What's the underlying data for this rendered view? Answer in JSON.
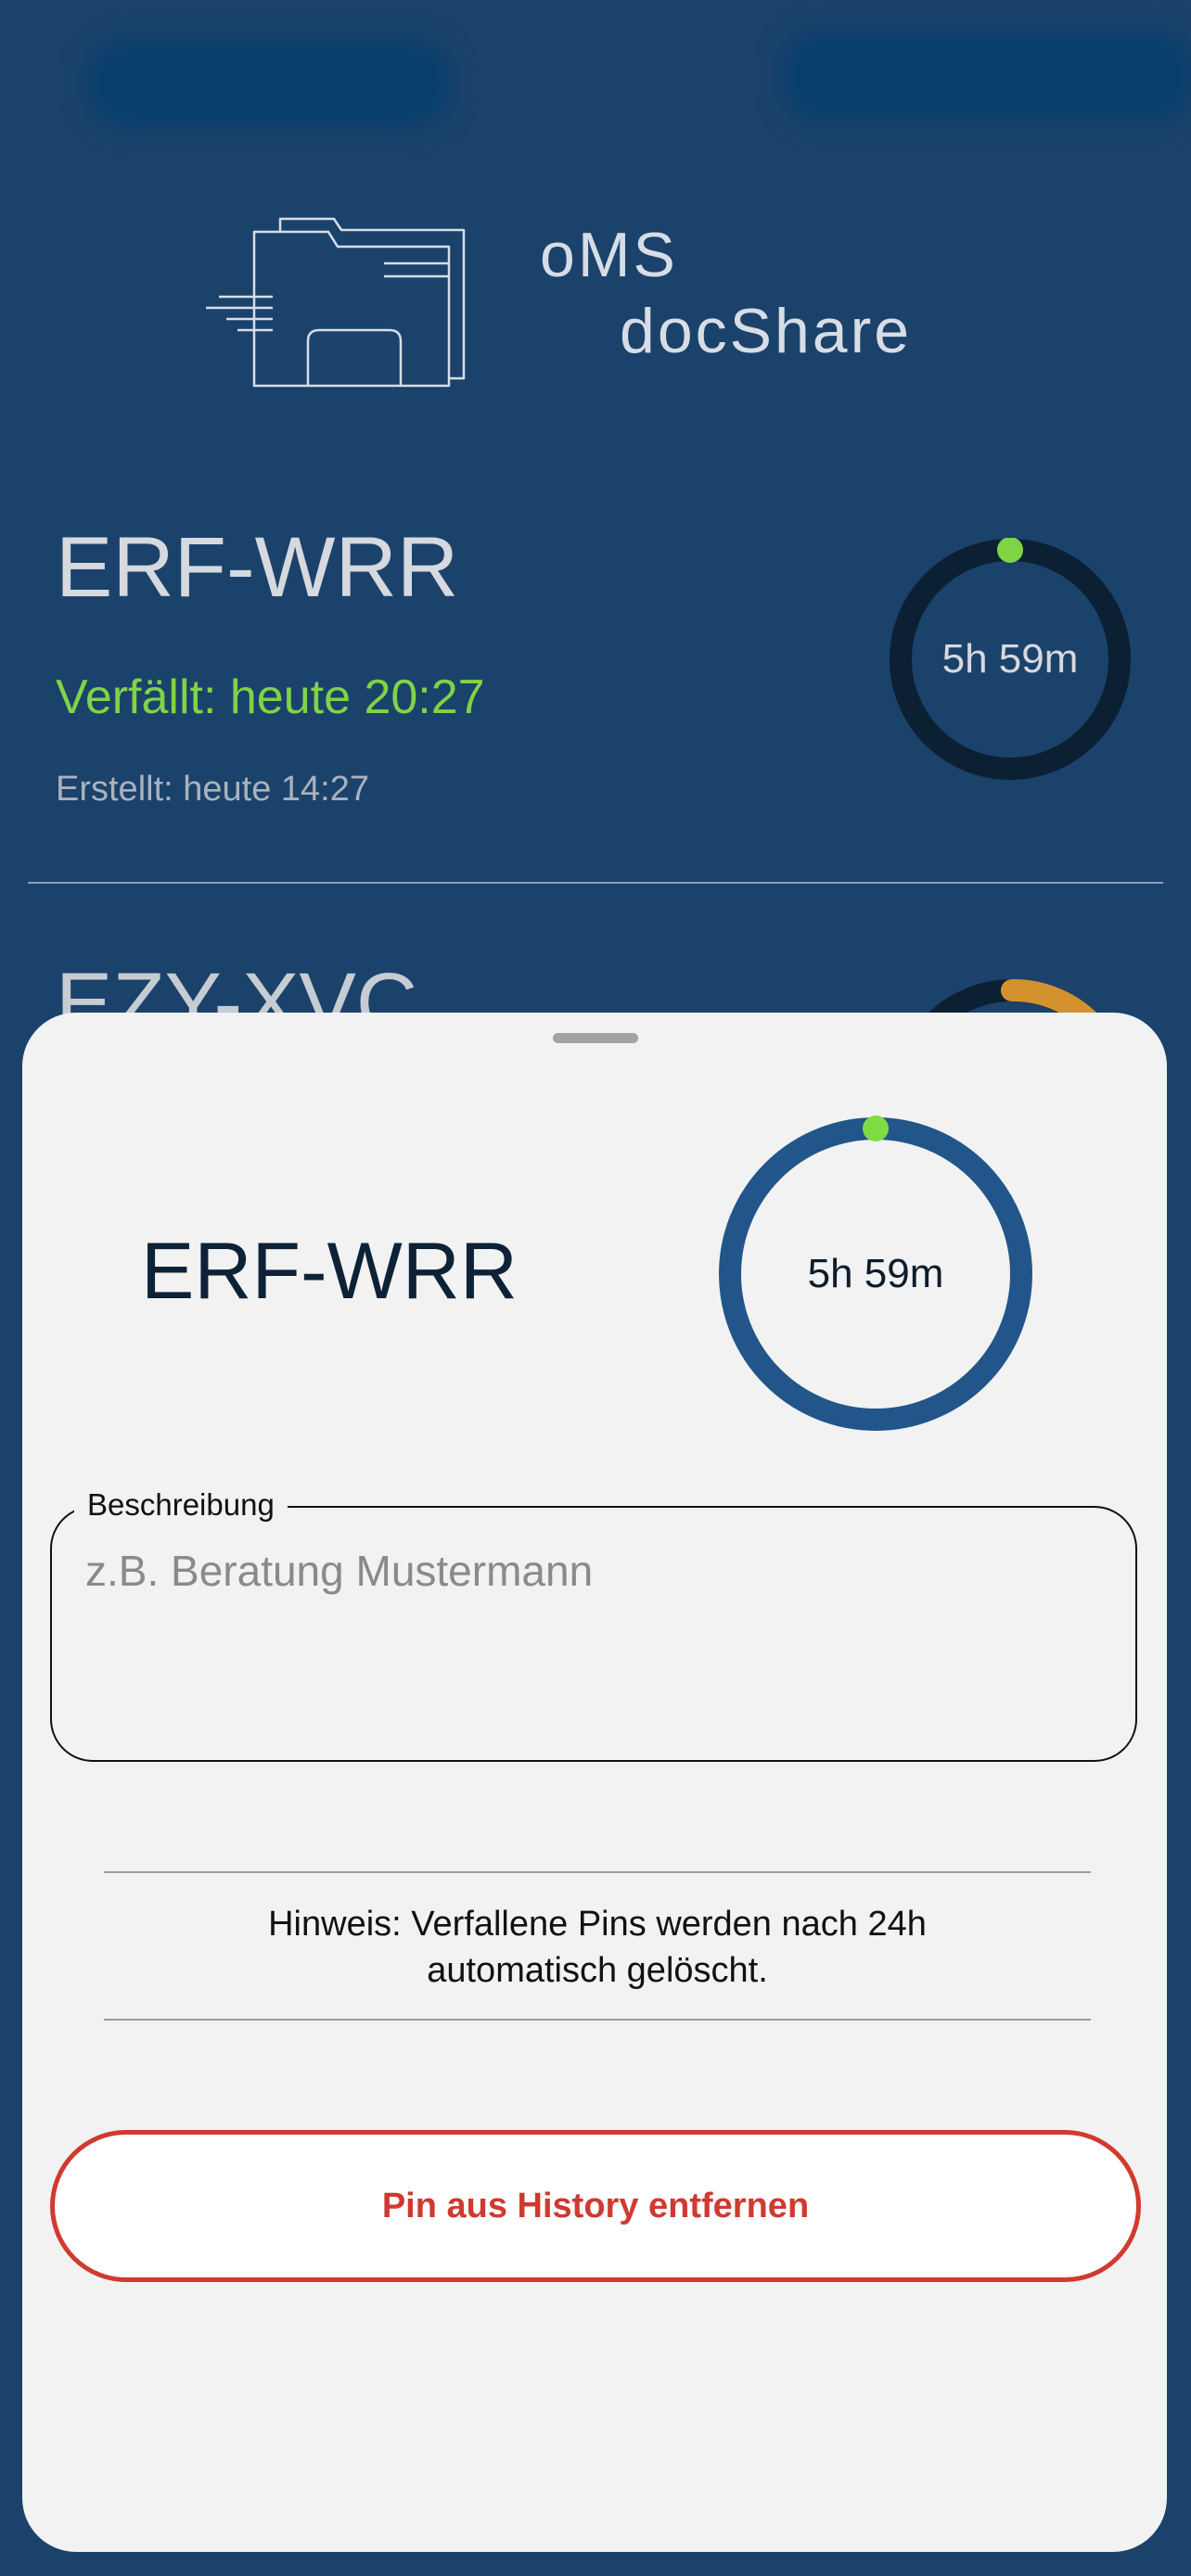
{
  "brand": {
    "line1": "oMS",
    "line2": "docShare",
    "icon": "folder-icon"
  },
  "background_pin": {
    "code": "ERF-WRR",
    "expiry": "Verfällt: heute 20:27",
    "created": "Erstellt: heute 14:27",
    "remaining": "5h 59m",
    "remaining_fraction": 1.0
  },
  "partial_pin": {
    "code": "EZY-XVC"
  },
  "sheet": {
    "code": "ERF-WRR",
    "remaining": "5h 59m",
    "description_label": "Beschreibung",
    "description_placeholder": "z.B. Beratung Mustermann",
    "description_value": "",
    "hint": "Hinweis: Verfallene Pins werden nach 24h automatisch gelöscht.",
    "remove_button": "Pin aus History entfernen"
  },
  "colors": {
    "background": "#1b426b",
    "expiry_green": "#7fd445",
    "ring_dark": "#0c2033",
    "ring_blue": "#225589",
    "ring_marker": "#7fdc45",
    "partial_ring_orange": "#d3922e",
    "danger": "#d03a2f"
  }
}
